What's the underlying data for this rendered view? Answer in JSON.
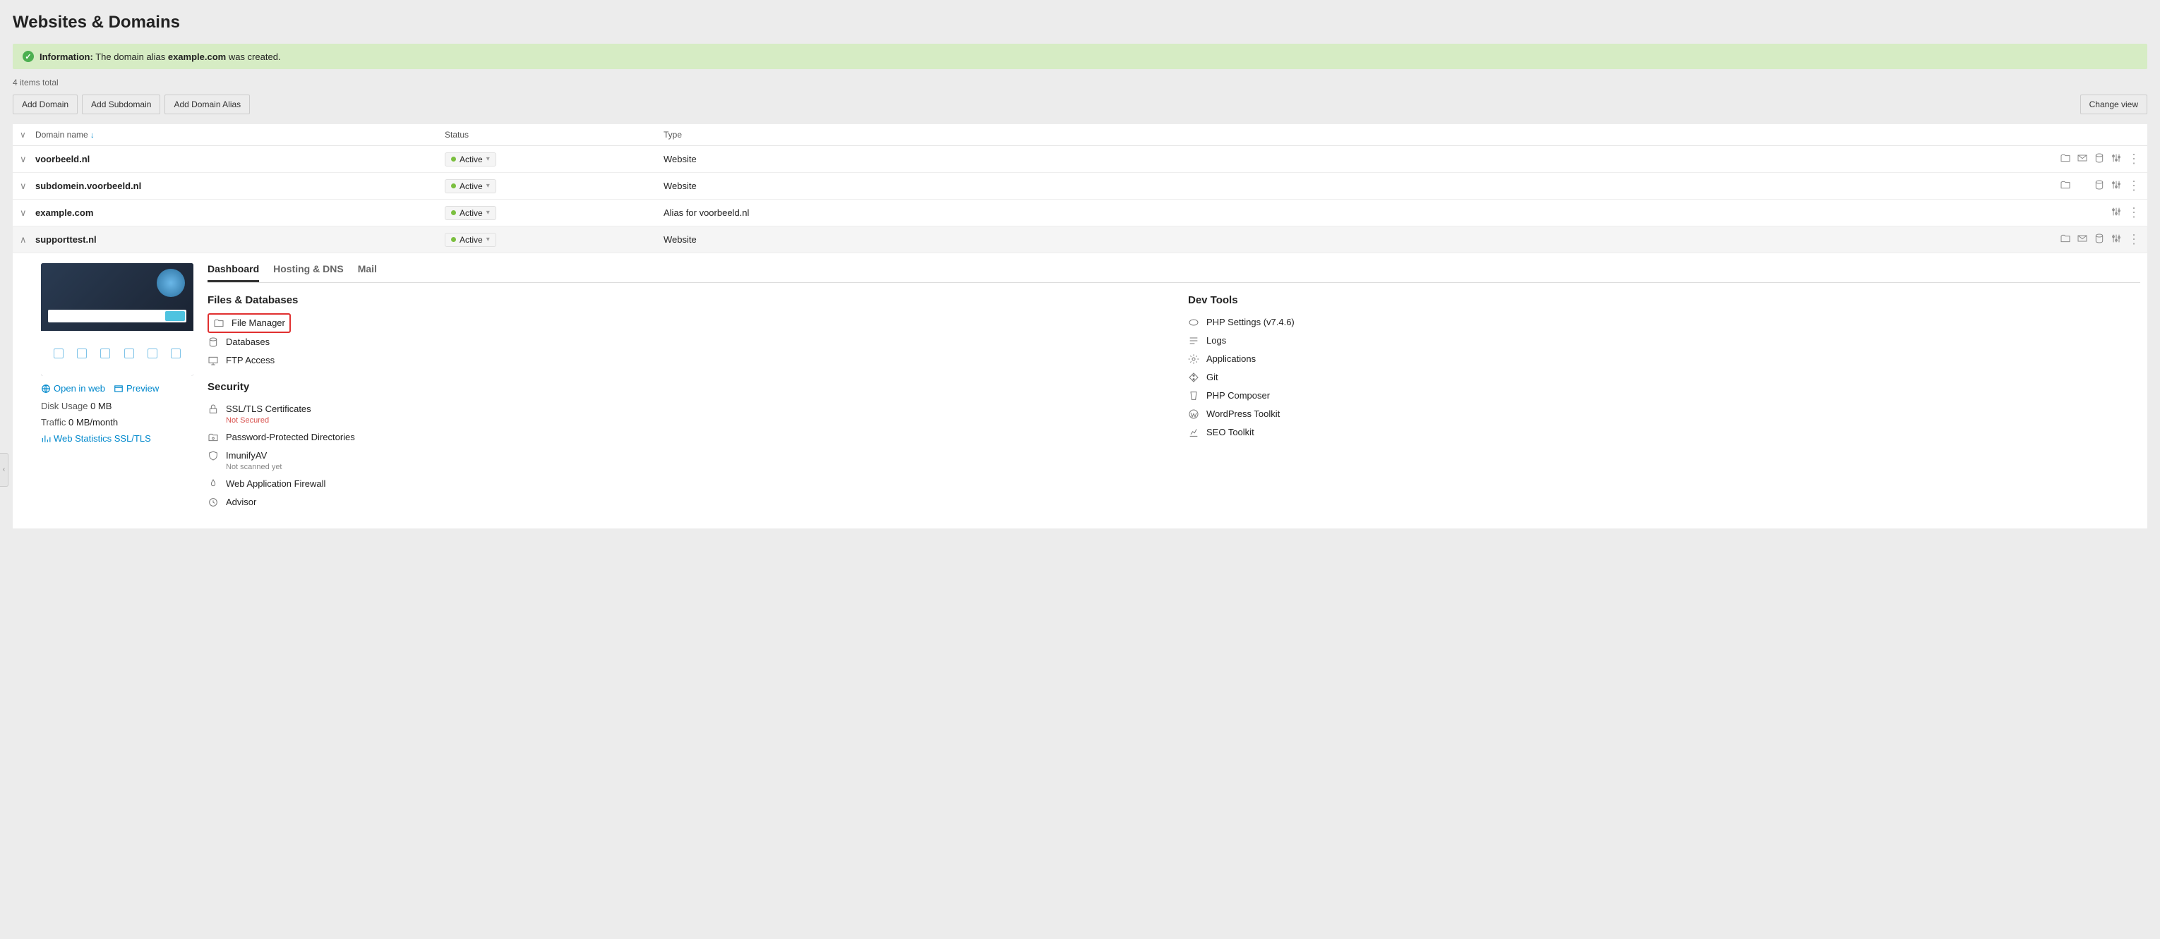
{
  "page_title": "Websites & Domains",
  "info_banner": {
    "label": "Information:",
    "prefix": "The domain alias ",
    "domain": "example.com",
    "suffix": " was created."
  },
  "items_total": "4 items total",
  "action_buttons": {
    "add_domain": "Add Domain",
    "add_subdomain": "Add Subdomain",
    "add_alias": "Add Domain Alias",
    "change_view": "Change view"
  },
  "columns": {
    "domain_name": "Domain name",
    "status": "Status",
    "type": "Type"
  },
  "rows": [
    {
      "name": "voorbeeld.nl",
      "status": "Active",
      "type": "Website",
      "expanded": false,
      "icons": [
        "folder",
        "mail",
        "db",
        "settings",
        "kebab"
      ]
    },
    {
      "name": "subdomein.voorbeeld.nl",
      "status": "Active",
      "type": "Website",
      "expanded": false,
      "icons": [
        "folder",
        "db",
        "settings",
        "kebab"
      ]
    },
    {
      "name": "example.com",
      "status": "Active",
      "type": "Alias for voorbeeld.nl",
      "expanded": false,
      "icons": [
        "settings",
        "kebab"
      ]
    },
    {
      "name": "supporttest.nl",
      "status": "Active",
      "type": "Website",
      "expanded": true,
      "icons": [
        "folder",
        "mail",
        "db",
        "settings",
        "kebab"
      ]
    }
  ],
  "detail": {
    "tabs": {
      "dashboard": "Dashboard",
      "hosting": "Hosting & DNS",
      "mail": "Mail"
    },
    "thumb_links": {
      "open": "Open in web",
      "preview": "Preview"
    },
    "thumb_meta": {
      "disk_label": "Disk Usage",
      "disk_value": "0 MB",
      "traffic_label": "Traffic",
      "traffic_value": "0 MB/month",
      "webstats": "Web Statistics SSL/TLS"
    },
    "sections": {
      "files": "Files & Databases",
      "security": "Security",
      "devtools": "Dev Tools"
    },
    "tools": {
      "file_manager": "File Manager",
      "databases": "Databases",
      "ftp": "FTP Access",
      "ssl": "SSL/TLS Certificates",
      "ssl_sub": "Not Secured",
      "passdir": "Password-Protected Directories",
      "imunify": "ImunifyAV",
      "imunify_sub": "Not scanned yet",
      "waf": "Web Application Firewall",
      "advisor": "Advisor",
      "php": "PHP Settings (v7.4.6)",
      "logs": "Logs",
      "apps": "Applications",
      "git": "Git",
      "composer": "PHP Composer",
      "wp": "WordPress Toolkit",
      "seo": "SEO Toolkit"
    }
  }
}
